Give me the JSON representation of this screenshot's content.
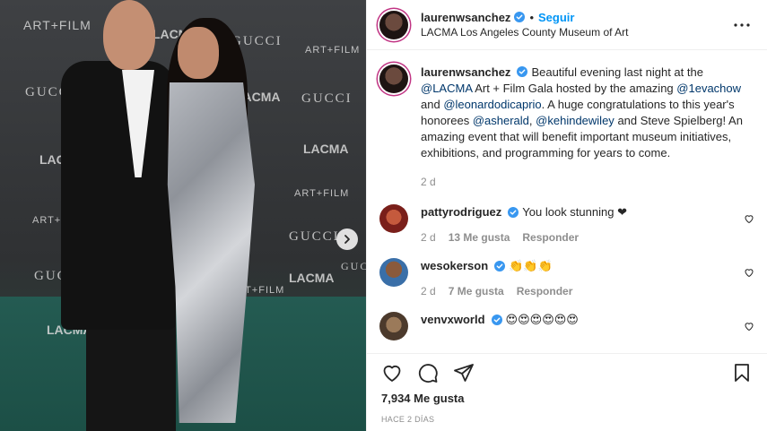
{
  "post": {
    "username": "laurenwsanchez",
    "follow_label": "Seguir",
    "location": "LACMA Los Angeles County Museum of Art"
  },
  "photo": {
    "backdrop_logos": {
      "artfilm": "ART+FILM",
      "lacma": "LACMA",
      "gucci": "GUCCI"
    }
  },
  "caption": {
    "username": "laurenwsanchez",
    "seg1": "Beautiful evening last night at the",
    "mention1": "@LACMA",
    "seg2": "Art + Film Gala hosted by the amazing",
    "mention2": "@1evachow",
    "seg3": "and",
    "mention3": "@leonardodicaprio",
    "seg4": ". A huge congratulations to this year's honorees",
    "mention4": "@asherald",
    "seg5": ",",
    "mention5": "@kehindewiley",
    "seg6": "and Steve Spielberg! An amazing event that will benefit important museum initiatives, exhibitions, and programming for years to come.",
    "time": "2 d"
  },
  "comments": [
    {
      "username": "pattyrodriguez",
      "text": "You look stunning ❤",
      "time": "2 d",
      "likes": "13 Me gusta",
      "reply": "Responder"
    },
    {
      "username": "wesokerson",
      "text": "👏👏👏",
      "time": "2 d",
      "likes": "7 Me gusta",
      "reply": "Responder"
    },
    {
      "username": "venvxworld",
      "text": "😍😍😍😍😍😍"
    }
  ],
  "likes_count": "7,934 Me gusta",
  "date_label": "HACE 2 DÍAS",
  "colors": {
    "accent": "#0095f6",
    "verified": "#3897f0",
    "mention": "#00376b",
    "muted": "#8e8e8e"
  },
  "icons": [
    "verified-icon",
    "more-options-icon",
    "heart-icon",
    "comment-icon",
    "share-icon",
    "bookmark-icon",
    "chevron-right-icon"
  ]
}
